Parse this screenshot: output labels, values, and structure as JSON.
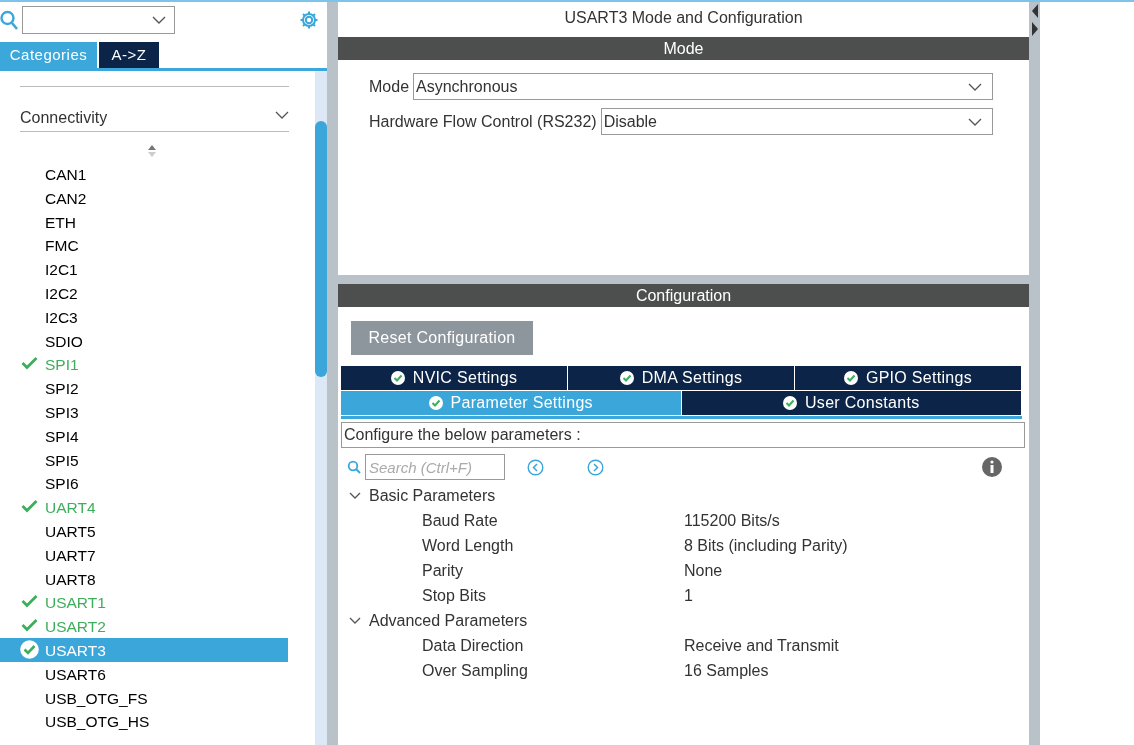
{
  "sidebar": {
    "view_tabs": [
      {
        "label": "Categories",
        "selected": true
      },
      {
        "label": "A->Z",
        "selected": false
      }
    ],
    "category": {
      "label": "Connectivity",
      "expanded": true
    },
    "items": [
      {
        "label": "CAN1",
        "configured": false,
        "selected": false
      },
      {
        "label": "CAN2",
        "configured": false,
        "selected": false
      },
      {
        "label": "ETH",
        "configured": false,
        "selected": false
      },
      {
        "label": "FMC",
        "configured": false,
        "selected": false
      },
      {
        "label": "I2C1",
        "configured": false,
        "selected": false
      },
      {
        "label": "I2C2",
        "configured": false,
        "selected": false
      },
      {
        "label": "I2C3",
        "configured": false,
        "selected": false
      },
      {
        "label": "SDIO",
        "configured": false,
        "selected": false
      },
      {
        "label": "SPI1",
        "configured": true,
        "selected": false
      },
      {
        "label": "SPI2",
        "configured": false,
        "selected": false
      },
      {
        "label": "SPI3",
        "configured": false,
        "selected": false
      },
      {
        "label": "SPI4",
        "configured": false,
        "selected": false
      },
      {
        "label": "SPI5",
        "configured": false,
        "selected": false
      },
      {
        "label": "SPI6",
        "configured": false,
        "selected": false
      },
      {
        "label": "UART4",
        "configured": true,
        "selected": false
      },
      {
        "label": "UART5",
        "configured": false,
        "selected": false
      },
      {
        "label": "UART7",
        "configured": false,
        "selected": false
      },
      {
        "label": "UART8",
        "configured": false,
        "selected": false
      },
      {
        "label": "USART1",
        "configured": true,
        "selected": false
      },
      {
        "label": "USART2",
        "configured": true,
        "selected": false
      },
      {
        "label": "USART3",
        "configured": true,
        "selected": true
      },
      {
        "label": "USART6",
        "configured": false,
        "selected": false
      },
      {
        "label": "USB_OTG_FS",
        "configured": false,
        "selected": false
      },
      {
        "label": "USB_OTG_HS",
        "configured": false,
        "selected": false
      }
    ]
  },
  "panel": {
    "title": "USART3 Mode and Configuration",
    "mode_header": "Mode",
    "mode_fields": [
      {
        "label": "Mode",
        "value": "Asynchronous"
      },
      {
        "label": "Hardware Flow Control (RS232)",
        "value": "Disable"
      }
    ],
    "config_header": "Configuration",
    "reset_button": "Reset Configuration",
    "tab_rows": [
      [
        {
          "label": "NVIC Settings",
          "selected": false
        },
        {
          "label": "DMA Settings",
          "selected": false
        },
        {
          "label": "GPIO Settings",
          "selected": false
        }
      ],
      [
        {
          "label": "Parameter Settings",
          "selected": true
        },
        {
          "label": "User Constants",
          "selected": false
        }
      ]
    ],
    "hint": "Configure the below parameters :",
    "search": {
      "placeholder": "Search (Ctrl+F)"
    },
    "groups": [
      {
        "label": "Basic Parameters",
        "expanded": true,
        "params": [
          {
            "name": "Baud Rate",
            "value": "115200 Bits/s"
          },
          {
            "name": "Word Length",
            "value": "8 Bits (including Parity)"
          },
          {
            "name": "Parity",
            "value": "None"
          },
          {
            "name": "Stop Bits",
            "value": "1"
          }
        ]
      },
      {
        "label": "Advanced Parameters",
        "expanded": true,
        "params": [
          {
            "name": "Data Direction",
            "value": "Receive and Transmit"
          },
          {
            "name": "Over Sampling",
            "value": "16 Samples"
          }
        ]
      }
    ]
  }
}
